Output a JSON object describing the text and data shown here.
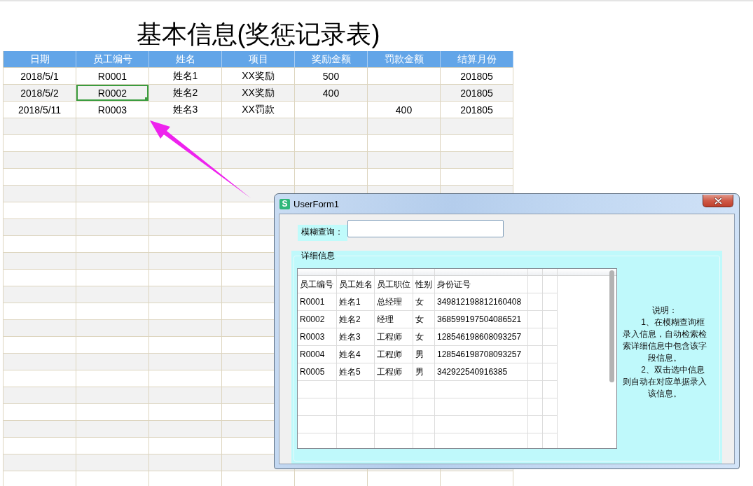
{
  "sheet": {
    "title": "基本信息(奖惩记录表)",
    "columns": [
      "日期",
      "员工编号",
      "姓名",
      "项目",
      "奖励金额",
      "罚款金额",
      "结算月份"
    ],
    "rows": [
      {
        "cells": [
          {
            "text": "2018/5/1",
            "selected": false
          },
          {
            "text": "R0001",
            "selected": false
          },
          {
            "text": "姓名1",
            "selected": false
          },
          {
            "text": "XX奖励",
            "selected": false
          },
          {
            "text": "500",
            "selected": false
          },
          {
            "selected": false
          },
          {
            "text": "201805",
            "selected": false
          }
        ]
      },
      {
        "cells": [
          {
            "text": "2018/5/2",
            "selected": false
          },
          {
            "text": "R0002",
            "selected": true
          },
          {
            "text": "姓名2",
            "selected": false
          },
          {
            "text": "XX奖励",
            "selected": false
          },
          {
            "text": "400",
            "selected": false
          },
          {
            "selected": false
          },
          {
            "text": "201805",
            "selected": false
          }
        ]
      },
      {
        "cells": [
          {
            "text": "2018/5/11",
            "selected": false
          },
          {
            "text": "R0003",
            "selected": false
          },
          {
            "text": "姓名3",
            "selected": false
          },
          {
            "text": "XX罚款",
            "selected": false
          },
          {
            "selected": false
          },
          {
            "text": "400",
            "selected": false
          },
          {
            "text": "201805",
            "selected": false
          }
        ]
      }
    ]
  },
  "dialog": {
    "title": "UserForm1",
    "icon_glyph": "S",
    "search": {
      "label": "模糊查询："
    },
    "details": {
      "legend": "详细信息",
      "list": {
        "rows": [
          [
            "员工编号",
            "员工姓名",
            "员工职位",
            "性别",
            "身份证号"
          ],
          [
            "R0001",
            "姓名1",
            "总经理",
            "女",
            "349812198812160408"
          ],
          [
            "R0002",
            "姓名2",
            "经理",
            "女",
            "368599197504086521"
          ],
          [
            "R0003",
            "姓名3",
            "工程师",
            "女",
            "128546198608093257"
          ],
          [
            "R0004",
            "姓名4",
            "工程师",
            "男",
            "128546198708093257"
          ],
          [
            "R0005",
            "姓名5",
            "工程师",
            "男",
            "342922540916385"
          ]
        ]
      },
      "note": {
        "title": "说明：",
        "items": [
          "1、在模糊查询框录入信息，自动检索检索详细信息中包含该字段信息。",
          "2、双击选中信息则自动在对应单据录入该信息。"
        ]
      }
    }
  }
}
